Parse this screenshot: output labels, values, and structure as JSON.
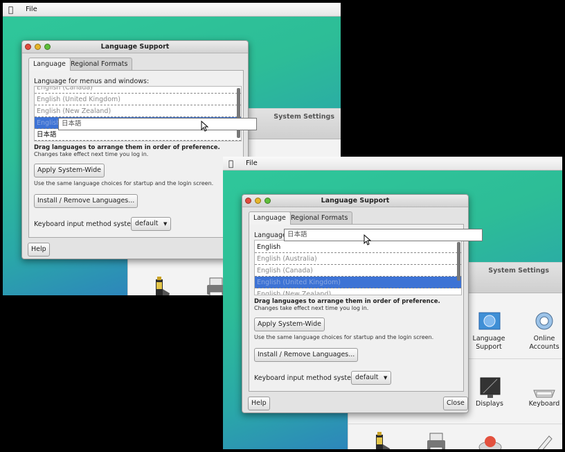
{
  "menubar": {
    "file_label": "File"
  },
  "settings": {
    "title": "System Settings"
  },
  "dialog": {
    "title": "Language Support",
    "tabs": [
      "Language",
      "Regional Formats"
    ],
    "list_label": "Language for menus and windows:",
    "drag_hint": "Drag languages to arrange them in order of preference.",
    "changes_hint": "Changes take effect next time you log in.",
    "apply_button": "Apply System-Wide",
    "apply_hint": "Use the same language choices for startup and the login screen.",
    "install_button": "Install / Remove Languages...",
    "keyboard_label": "Keyboard input method system:",
    "keyboard_value": "default",
    "help_button": "Help",
    "close_button": "Close",
    "dragged_item": "日本語"
  },
  "shot1": {
    "languages": [
      "English (Canada)",
      "English (United Kingdom)",
      "English (New Zealand)",
      "English",
      "日本語"
    ]
  },
  "shot2": {
    "list_label_partial": "Language",
    "languages": [
      "English",
      "English (Australia)",
      "English (Canada)",
      "English (United Kingdom)",
      "English (New Zealand)"
    ]
  },
  "settings_items": {
    "language_support": "Language Support",
    "online_accounts": "Online Accounts",
    "displays": "Displays",
    "keyboard": "Keyboard"
  },
  "icons": [
    "apple-icon",
    "battery-icon",
    "printer-icon",
    "flag-icon",
    "online-accounts-icon",
    "displays-icon",
    "keyboard-icon",
    "hat-icon",
    "pen-icon"
  ],
  "colors": {
    "selection": "#3d73d5",
    "desktop": "#2dbd97"
  }
}
